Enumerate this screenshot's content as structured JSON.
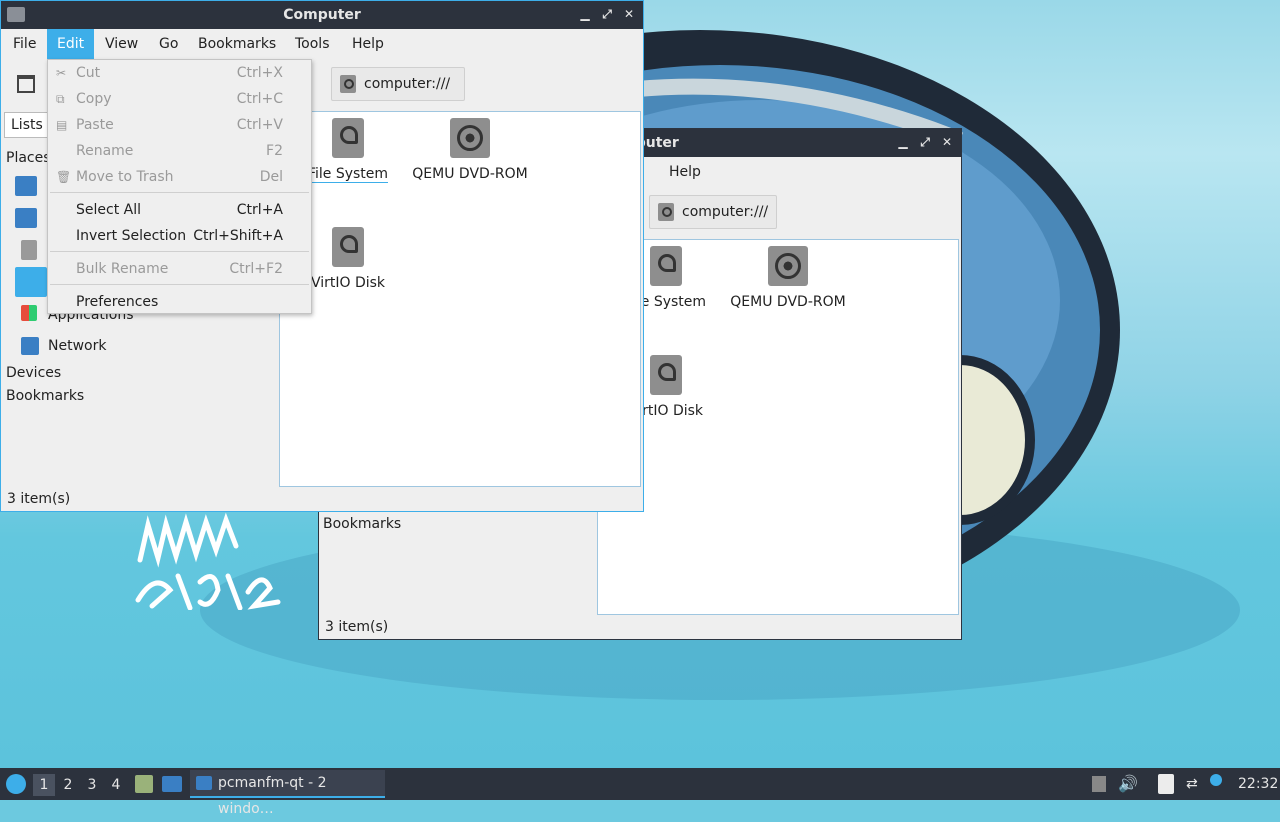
{
  "window_main": {
    "title": "Computer",
    "menu": [
      "File",
      "Edit",
      "View",
      "Go",
      "Bookmarks",
      "Tools",
      "Help"
    ],
    "path": "computer:///",
    "side_tab": "Lists",
    "places_header": "Places",
    "places": [
      "Applications",
      "Network"
    ],
    "devices_header": "Devices",
    "bookmarks_header": "Bookmarks",
    "files": [
      "File System",
      "QEMU DVD-ROM",
      "VirtIO Disk"
    ],
    "status": "3 item(s)"
  },
  "window_back": {
    "title": "Computer",
    "menu": [
      "Help"
    ],
    "path": "computer:///",
    "bookmarks_header": "Bookmarks",
    "files": [
      "File System",
      "QEMU DVD-ROM",
      "VirtIO Disk"
    ],
    "status": "3 item(s)"
  },
  "edit_menu": {
    "items": [
      {
        "label": "Cut",
        "shortcut": "Ctrl+X"
      },
      {
        "label": "Copy",
        "shortcut": "Ctrl+C"
      },
      {
        "label": "Paste",
        "shortcut": "Ctrl+V"
      },
      {
        "label": "Rename",
        "shortcut": "F2"
      },
      {
        "label": "Move to Trash",
        "shortcut": "Del"
      },
      {
        "label": "Select All",
        "shortcut": "Ctrl+A"
      },
      {
        "label": "Invert Selection",
        "shortcut": "Ctrl+Shift+A"
      },
      {
        "label": "Bulk Rename",
        "shortcut": "Ctrl+F2"
      },
      {
        "label": "Preferences",
        "shortcut": ""
      }
    ]
  },
  "desktop": {
    "signature_text": "NNN 2/5/22"
  },
  "taskbar": {
    "desktops": [
      "1",
      "2",
      "3",
      "4"
    ],
    "task": "pcmanfm-qt - 2 windo…",
    "clock": "22:32"
  },
  "colors": {
    "accent": "#3daee9",
    "titlebar": "#2c323d",
    "window_bg": "#efefef"
  }
}
